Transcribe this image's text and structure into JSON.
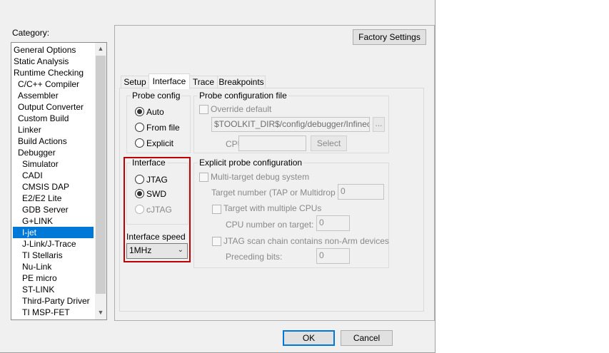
{
  "category_label": "Category:",
  "categories": [
    {
      "label": "General Options",
      "indent": 0
    },
    {
      "label": "Static Analysis",
      "indent": 0
    },
    {
      "label": "Runtime Checking",
      "indent": 0
    },
    {
      "label": "C/C++ Compiler",
      "indent": 1
    },
    {
      "label": "Assembler",
      "indent": 1
    },
    {
      "label": "Output Converter",
      "indent": 1
    },
    {
      "label": "Custom Build",
      "indent": 1
    },
    {
      "label": "Linker",
      "indent": 1
    },
    {
      "label": "Build Actions",
      "indent": 1
    },
    {
      "label": "Debugger",
      "indent": 1
    },
    {
      "label": "Simulator",
      "indent": 2
    },
    {
      "label": "CADI",
      "indent": 2
    },
    {
      "label": "CMSIS DAP",
      "indent": 2
    },
    {
      "label": "E2/E2 Lite",
      "indent": 2
    },
    {
      "label": "GDB Server",
      "indent": 2
    },
    {
      "label": "G+LINK",
      "indent": 2
    },
    {
      "label": "I-jet",
      "indent": 2,
      "selected": true
    },
    {
      "label": "J-Link/J-Trace",
      "indent": 2
    },
    {
      "label": "TI Stellaris",
      "indent": 2
    },
    {
      "label": "Nu-Link",
      "indent": 2
    },
    {
      "label": "PE micro",
      "indent": 2
    },
    {
      "label": "ST-LINK",
      "indent": 2
    },
    {
      "label": "Third-Party Driver",
      "indent": 2
    },
    {
      "label": "TI MSP-FET",
      "indent": 2
    }
  ],
  "factory_settings": "Factory Settings",
  "tabs": [
    "Setup",
    "Interface",
    "Trace",
    "Breakpoints"
  ],
  "active_tab": "Interface",
  "probe_config": {
    "title": "Probe config",
    "options": [
      {
        "label": "Auto",
        "checked": true
      },
      {
        "label": "From file",
        "checked": false
      },
      {
        "label": "Explicit",
        "checked": false
      }
    ]
  },
  "probe_file": {
    "title": "Probe configuration file",
    "override_label": "Override default",
    "path": "$TOOLKIT_DIR$/config/debugger/Infineon/",
    "browse": "...",
    "cpu_label": "CPU:",
    "cpu_value": "",
    "select_label": "Select"
  },
  "interface": {
    "title": "Interface",
    "options": [
      {
        "label": "JTAG",
        "checked": false,
        "enabled": true
      },
      {
        "label": "SWD",
        "checked": true,
        "enabled": true
      },
      {
        "label": "cJTAG",
        "checked": false,
        "enabled": false
      }
    ],
    "speed_label": "Interface speed",
    "speed_value": "1MHz"
  },
  "explicit": {
    "title": "Explicit probe configuration",
    "multi_target": "Multi-target debug system",
    "target_number_label": "Target number (TAP or Multidrop ID):",
    "target_number": "0",
    "multi_cpu": "Target with multiple CPUs",
    "cpu_number_label": "CPU number on target:",
    "cpu_number": "0",
    "jtag_chain": "JTAG scan chain contains non-Arm devices",
    "preceding_label": "Preceding bits:",
    "preceding": "0"
  },
  "ok": "OK",
  "cancel": "Cancel",
  "colors": {
    "selection": "#0078d7",
    "highlight_border": "#c00000"
  }
}
